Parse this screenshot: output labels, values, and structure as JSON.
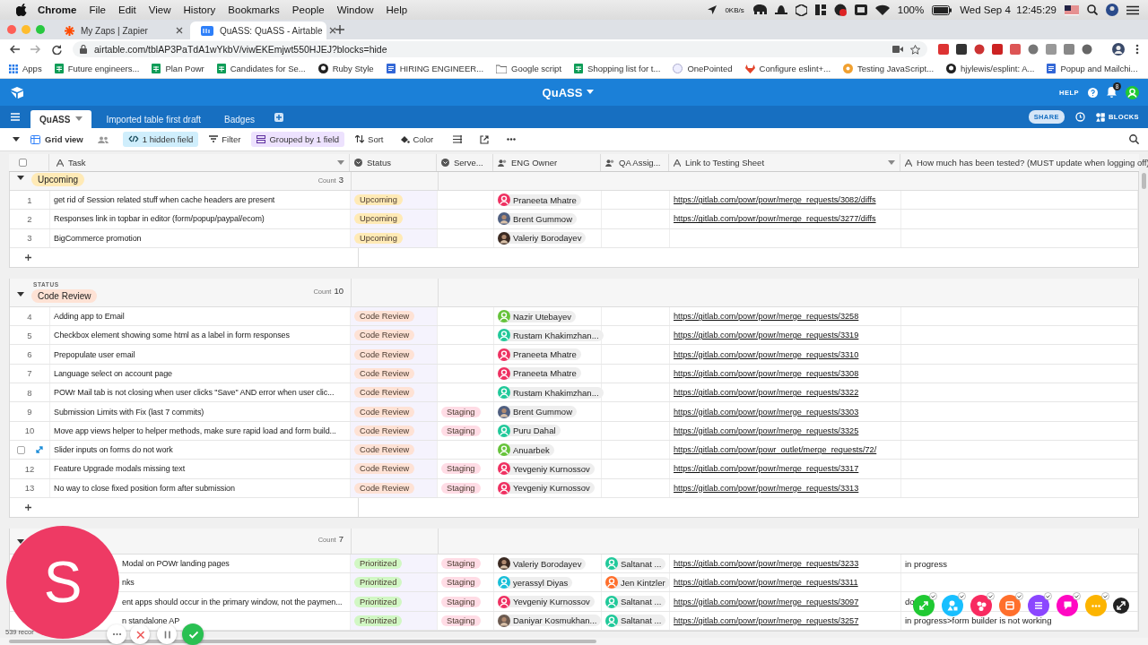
{
  "menubar": {
    "app": "Chrome",
    "menus": [
      "File",
      "Edit",
      "View",
      "History",
      "Bookmarks",
      "People",
      "Window",
      "Help"
    ],
    "network": "0KB/s",
    "battery": "100%",
    "clock": "Wed Sep 4  12:45:29"
  },
  "browser": {
    "tabs": [
      {
        "title": "My Zaps | Zapier",
        "kind": "zapier",
        "selected": false
      },
      {
        "title": "QuASS: QuASS - Airtable",
        "kind": "airtable",
        "selected": true
      }
    ],
    "url": "airtable.com/tblAP3PaTdA1wYkbV/viwEKEmjwt550HJEJ?blocks=hide",
    "bookmarks": [
      {
        "label": "Apps",
        "kind": "apps"
      },
      {
        "label": "Future engineers...",
        "kind": "sheet"
      },
      {
        "label": "Plan Powr",
        "kind": "sheet"
      },
      {
        "label": "Candidates for Se...",
        "kind": "sheet"
      },
      {
        "label": "Ruby Style",
        "kind": "github"
      },
      {
        "label": "HIRING ENGINEER...",
        "kind": "doc"
      },
      {
        "label": "Google script",
        "kind": "folder"
      },
      {
        "label": "Shopping list for t...",
        "kind": "sheet"
      },
      {
        "label": "OnePointed",
        "kind": "globe"
      },
      {
        "label": "Configure eslint+...",
        "kind": "gitlab"
      },
      {
        "label": "Testing JavaScript...",
        "kind": "orange"
      },
      {
        "label": "hjylewis/esplint: A...",
        "kind": "github"
      },
      {
        "label": "Popup and Mailchi...",
        "kind": "doc"
      }
    ]
  },
  "base": {
    "title": "QuASS",
    "help": "HELP",
    "notifications": "8",
    "tables": [
      {
        "label": "QuASS",
        "selected": true
      },
      {
        "label": "Imported table first draft",
        "selected": false
      },
      {
        "label": "Badges",
        "selected": false
      }
    ],
    "share": "SHARE",
    "blocks": "BLOCKS"
  },
  "toolbar": {
    "view": "Grid view",
    "hidden_fields": "1 hidden field",
    "filter": "Filter",
    "grouped": "Grouped by 1 field",
    "sort": "Sort",
    "color_label": "Color"
  },
  "table": {
    "select_all": {
      "checked": false
    },
    "columns": [
      "Task",
      "Status",
      "Serve...",
      "ENG Owner",
      "QA Assig...",
      "Link to Testing Sheet",
      "How much has been tested? (MUST update when logging off)"
    ],
    "groups": [
      {
        "status": {
          "label": "Upcoming",
          "color": "#ffeab6"
        },
        "count_label": "Count",
        "count": "3",
        "rows": [
          {
            "number": "1",
            "hovered": false,
            "task": "get rid of Session related stuff when cache headers are present",
            "status": {
              "label": "Upcoming",
              "color": "#ffeab6"
            },
            "owner": {
              "name": "Praneeta Mhatre",
              "kind": "default",
              "color": "#ef3061"
            },
            "link": "https://gitlab.com/powr/powr/merge_requests/3082/diffs"
          },
          {
            "number": "2",
            "hovered": false,
            "task": "Responses link in topbar in editor (form/popup/paypal/ecom)",
            "status": {
              "label": "Upcoming",
              "color": "#ffeab6"
            },
            "owner": {
              "name": "Brent Gummow",
              "kind": "photo",
              "color": "#4f5f80"
            },
            "link": "https://gitlab.com/powr/powr/merge_requests/3277/diffs"
          },
          {
            "number": "3",
            "hovered": false,
            "task": "BigCommerce promotion",
            "status": {
              "label": "Upcoming",
              "color": "#ffeab6"
            },
            "owner": {
              "name": "Valeriy Borodayev",
              "kind": "photo",
              "color": "#3b2a22"
            }
          }
        ]
      },
      {
        "field_label": "STATUS",
        "status": {
          "label": "Code Review",
          "color": "#fee2d5"
        },
        "count_label": "Count",
        "count": "10",
        "rows": [
          {
            "number": "4",
            "hovered": false,
            "task": "Adding app to Email",
            "status": {
              "label": "Code Review",
              "color": "#fee2d5"
            },
            "owner": {
              "name": "Nazir Utebayev",
              "kind": "default",
              "color": "#66c33a"
            },
            "link": "https://gitlab.com/powr/powr/merge_requests/3258"
          },
          {
            "number": "5",
            "hovered": false,
            "task": "Checkbox element showing some html as a label in form responses",
            "status": {
              "label": "Code Review",
              "color": "#fee2d5"
            },
            "owner": {
              "name": "Rustam Khakimzhan...",
              "kind": "default",
              "color": "#20c99a"
            },
            "link": "https://gitlab.com/powr/powr/merge_requests/3319"
          },
          {
            "number": "6",
            "hovered": false,
            "task": "Prepopulate user email",
            "status": {
              "label": "Code Review",
              "color": "#fee2d5"
            },
            "owner": {
              "name": "Praneeta Mhatre",
              "kind": "default",
              "color": "#ef3061"
            },
            "link": "https://gitlab.com/powr/powr/merge_requests/3310"
          },
          {
            "number": "7",
            "hovered": false,
            "task": "Language select on account page",
            "status": {
              "label": "Code Review",
              "color": "#fee2d5"
            },
            "owner": {
              "name": "Praneeta Mhatre",
              "kind": "default",
              "color": "#ef3061"
            },
            "link": "https://gitlab.com/powr/powr/merge_requests/3308"
          },
          {
            "number": "8",
            "hovered": false,
            "task": "POWr Mail tab is not closing when user clicks \"Save\" AND error when user clic...",
            "status": {
              "label": "Code Review",
              "color": "#fee2d5"
            },
            "owner": {
              "name": "Rustam Khakimzhan...",
              "kind": "default",
              "color": "#20c99a"
            },
            "link": "https://gitlab.com/powr/powr/merge_requests/3322"
          },
          {
            "number": "9",
            "hovered": false,
            "task": "Submission Limits with Fix (last 7 commits)",
            "status": {
              "label": "Code Review",
              "color": "#fee2d5"
            },
            "server": {
              "label": "Staging",
              "color": "#ffdce5"
            },
            "owner": {
              "name": "Brent Gummow",
              "kind": "photo",
              "color": "#4f5f80"
            },
            "link": "https://gitlab.com/powr/powr/merge_requests/3303"
          },
          {
            "number": "10",
            "hovered": false,
            "task": "Move app views helper to helper methods, make sure rapid load and form build...",
            "status": {
              "label": "Code Review",
              "color": "#fee2d5"
            },
            "server": {
              "label": "Staging",
              "color": "#ffdce5"
            },
            "owner": {
              "name": "Puru Dahal",
              "kind": "default",
              "color": "#20c99a"
            },
            "link": "https://gitlab.com/powr/powr/merge_requests/3325"
          },
          {
            "hovered": true,
            "task": "Slider inputs on forms do not work",
            "status": {
              "label": "Code Review",
              "color": "#fee2d5"
            },
            "owner": {
              "name": "Anuarbek",
              "kind": "default",
              "color": "#66c33a"
            },
            "link": "https://gitlab.com/powr/powr_outlet/merge_requests/72/"
          },
          {
            "number": "12",
            "hovered": false,
            "task": "Feature Upgrade modals missing text",
            "status": {
              "label": "Code Review",
              "color": "#fee2d5"
            },
            "server": {
              "label": "Staging",
              "color": "#ffdce5"
            },
            "owner": {
              "name": "Yevgeniy Kurnossov",
              "kind": "default",
              "color": "#ef3061"
            },
            "link": "https://gitlab.com/powr/powr/merge_requests/3317"
          },
          {
            "number": "13",
            "hovered": false,
            "task": "No way to close fixed position form after submission",
            "status": {
              "label": "Code Review",
              "color": "#fee2d5"
            },
            "server": {
              "label": "Staging",
              "color": "#ffdce5"
            },
            "owner": {
              "name": "Yevgeniy Kurnossov",
              "kind": "default",
              "color": "#ef3061"
            },
            "link": "https://gitlab.com/powr/powr/merge_requests/3313"
          }
        ]
      },
      {
        "count_label": "Count",
        "count": "7",
        "rows": [
          {
            "hovered": false,
            "task": "Modal on POWr landing pages",
            "status": {
              "label": "Prioritized",
              "color": "#d1f7c4"
            },
            "server": {
              "label": "Staging",
              "color": "#ffdce5"
            },
            "owner": {
              "name": "Valeriy Borodayev",
              "kind": "photo",
              "color": "#3b2a22"
            },
            "qa": {
              "name": "Saltanat ...",
              "kind": "default",
              "color": "#20c99a"
            },
            "link": "https://gitlab.com/powr/powr/merge_requests/3233",
            "tested": "in progress"
          },
          {
            "hovered": false,
            "task": "nks",
            "status": {
              "label": "Prioritized",
              "color": "#d1f7c4"
            },
            "server": {
              "label": "Staging",
              "color": "#ffdce5"
            },
            "owner": {
              "name": "yerassyl Diyas",
              "kind": "default",
              "color": "#18bfd8"
            },
            "qa": {
              "name": "Jen Kintzler",
              "kind": "default",
              "color": "#ff6f2c"
            },
            "link": "https://gitlab.com/powr/powr/merge_requests/3311"
          },
          {
            "hovered": false,
            "task": "ent apps should occur in the primary window, not the paymen...",
            "status": {
              "label": "Prioritized",
              "color": "#d1f7c4"
            },
            "server": {
              "label": "Staging",
              "color": "#ffdce5"
            },
            "owner": {
              "name": "Yevgeniy Kurnossov",
              "kind": "default",
              "color": "#ef3061"
            },
            "qa": {
              "name": "Saltanat ...",
              "kind": "default",
              "color": "#20c99a"
            },
            "link": "https://gitlab.com/powr/powr/merge_requests/3097",
            "tested": "do"
          },
          {
            "hovered": false,
            "task": "n standalone AP",
            "status": {
              "label": "Prioritized",
              "color": "#d1f7c4"
            },
            "server": {
              "label": "Staging",
              "color": "#ffdce5"
            },
            "owner": {
              "name": "Daniyar Kosmukhan...",
              "kind": "photo",
              "color": "#6b5a50"
            },
            "qa": {
              "name": "Saltanat ...",
              "kind": "default",
              "color": "#20c99a"
            },
            "link": "https://gitlab.com/powr/powr/merge_requests/3257",
            "tested": "in progress>form builder is not working"
          }
        ]
      }
    ]
  },
  "status_bar": {
    "records": "539 recor"
  },
  "recorder": {
    "initial": "S"
  },
  "blocks": [
    {
      "color": "#20c933"
    },
    {
      "color": "#18bfff"
    },
    {
      "color": "#f82b60"
    },
    {
      "color": "#ff6f2c"
    },
    {
      "color": "#8b46ff"
    },
    {
      "color": "#ff08c2"
    },
    {
      "color": "#fcb400"
    }
  ]
}
